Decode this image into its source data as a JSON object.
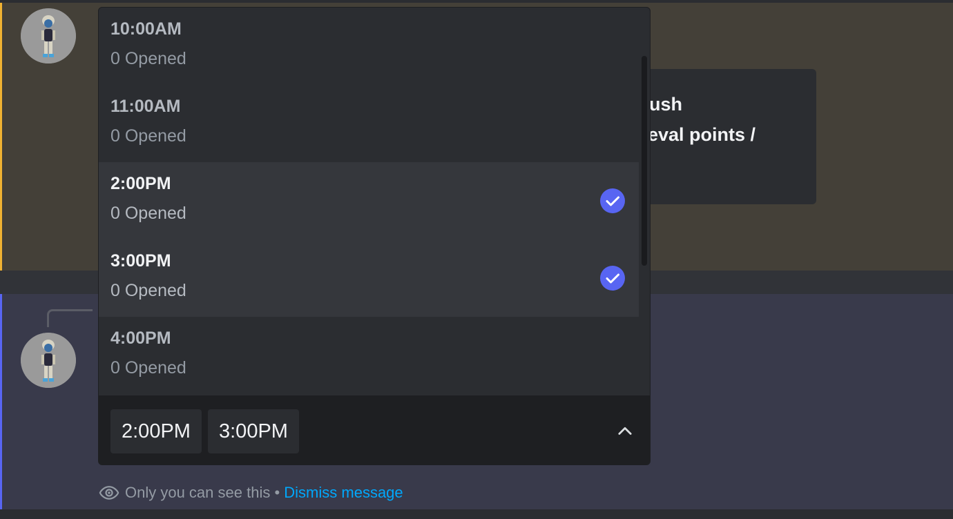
{
  "select_menu": {
    "options": [
      {
        "label": "10:00AM",
        "description": "0 Opened",
        "selected": false
      },
      {
        "label": "11:00AM",
        "description": "0 Opened",
        "selected": false
      },
      {
        "label": "2:00PM",
        "description": "0 Opened",
        "selected": true
      },
      {
        "label": "3:00PM",
        "description": "0 Opened",
        "selected": true
      },
      {
        "label": "4:00PM",
        "description": "0 Opened",
        "selected": false
      }
    ],
    "selected_values": [
      "2:00PM",
      "3:00PM"
    ],
    "expanded_icon": "chevron-up-icon",
    "check_icon": "check-circle-icon",
    "accent_color": "#5865f2"
  },
  "embed": {
    "line1": "ush",
    "line2": "g eval points /"
  },
  "ephemeral": {
    "notice": "Only you can see this",
    "separator": " • ",
    "dismiss_label": "Dismiss message",
    "icon": "eye-icon"
  },
  "colors": {
    "mention_highlight": "#444038",
    "mention_bar": "#f0b232",
    "ephemeral_bar": "#5865f2",
    "link": "#00a8fc"
  }
}
